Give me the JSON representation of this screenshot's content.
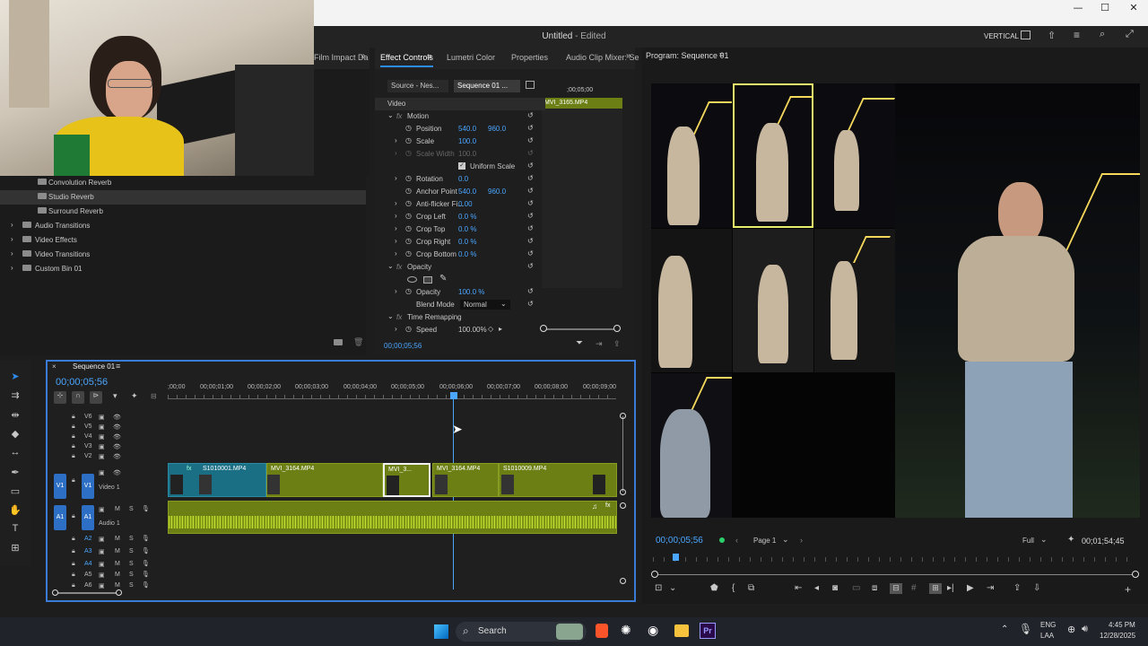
{
  "window": {
    "title": "Untitled",
    "status": "- Edited",
    "minimize": "—",
    "maximize": "☐",
    "close": "✕"
  },
  "header": {
    "workspace": "VERTICAL"
  },
  "left_top_tab": "Film Impact Da",
  "project": {
    "items": [
      "Convolution Reverb",
      "Studio Reverb",
      "Surround Reverb"
    ],
    "folders": [
      "Audio Transitions",
      "Video Effects",
      "Video Transitions",
      "Custom Bin 01"
    ]
  },
  "effect_tabs": [
    "Effect Controls",
    "Lumetri Color",
    "Properties",
    "Audio Clip Mixer: Se"
  ],
  "effect_controls": {
    "source": "Source - Nes...",
    "sequence": "Sequence 01 ...",
    "mini_tc": ";00;05;00",
    "clip": "MVI_3165.MP4",
    "section_video": "Video",
    "motion": "Motion",
    "position": {
      "label": "Position",
      "x": "540.0",
      "y": "960.0"
    },
    "scale": {
      "label": "Scale",
      "v": "100.0"
    },
    "scale_width": {
      "label": "Scale Width",
      "v": "100.0"
    },
    "uniform": "Uniform Scale",
    "rotation": {
      "label": "Rotation",
      "v": "0.0"
    },
    "anchor": {
      "label": "Anchor Point",
      "x": "540.0",
      "y": "960.0"
    },
    "antiflicker": {
      "label": "Anti-flicker Fi...",
      "v": "0.00"
    },
    "crop_left": {
      "label": "Crop Left",
      "v": "0.0 %"
    },
    "crop_top": {
      "label": "Crop Top",
      "v": "0.0 %"
    },
    "crop_right": {
      "label": "Crop Right",
      "v": "0.0 %"
    },
    "crop_bottom": {
      "label": "Crop Bottom",
      "v": "0.0 %"
    },
    "opacity_section": "Opacity",
    "opacity": {
      "label": "Opacity",
      "v": "100.0 %"
    },
    "blend": {
      "label": "Blend Mode",
      "v": "Normal"
    },
    "time_remap": "Time Remapping",
    "speed": {
      "label": "Speed",
      "v": "100.00%"
    },
    "timecode": "00;00;05;56"
  },
  "timeline": {
    "tab": "Sequence 01",
    "timecode": "00;00;05;56",
    "ruler": [
      ";00;00",
      "00;00;01;00",
      "00;00;02;00",
      "00;00;03;00",
      "00;00;04;00",
      "00;00;05;00",
      "00;00;06;00",
      "00;00;07;00",
      "00;00;08;00",
      "00;00;09;00"
    ],
    "video_tracks": [
      "V6",
      "V5",
      "V4",
      "V3",
      "V2"
    ],
    "v1": "V1",
    "v1_name": "Video 1",
    "a1": "A1",
    "a1_name": "Audio 1",
    "audio_tracks": [
      "A2",
      "A3",
      "A4",
      "A5",
      "A6"
    ],
    "clips": [
      "S1010001.MP4",
      "MVI_3164.MP4",
      "MVI_3...",
      "MVI_3164.MP4",
      "S1010009.MP4"
    ]
  },
  "program": {
    "title": "Program: Sequence 01",
    "timecode": "00;00;05;56",
    "page": "Page 1",
    "zoom": "Full",
    "duration": "00;01;54;45"
  },
  "taskbar": {
    "search": "Search",
    "lang1": "ENG",
    "lang2": "LAA",
    "time": "4:45 PM",
    "date": "12/28/2025"
  },
  "colors": {
    "accent": "#2d8ceb",
    "clip_video": "#6b7f14",
    "clip_audio": "#6b7f14",
    "teal_clip": "#1b6f85"
  }
}
